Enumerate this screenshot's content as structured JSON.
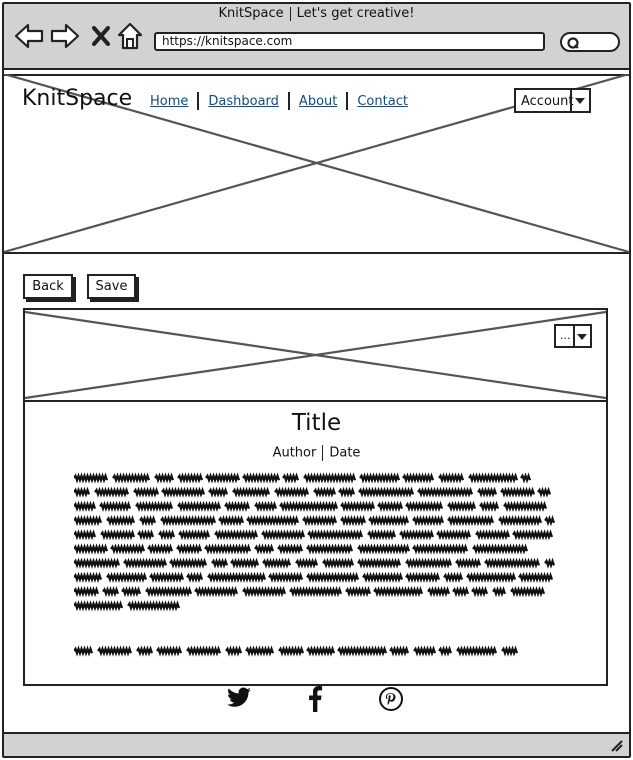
{
  "browser": {
    "title": "KnitSpace",
    "subtitle": "Let's get creative!",
    "url": "https://knitspace.com",
    "icons": [
      "back-arrow-icon",
      "forward-arrow-icon",
      "close-icon",
      "home-icon",
      "search-icon"
    ]
  },
  "header": {
    "logo": "KnitSpace",
    "nav": [
      "Home",
      "Dashboard",
      "About",
      "Contact"
    ],
    "account_label": "Account"
  },
  "toolbar": {
    "back_label": "Back",
    "save_label": "Save"
  },
  "image_menu": {
    "label": "..."
  },
  "article": {
    "title": "Title",
    "author": "Author",
    "date": "Date",
    "paragraph_lines": 10,
    "second_paragraph_lines": 1
  },
  "social": [
    "twitter-icon",
    "facebook-icon",
    "pinterest-icon"
  ],
  "colors": {
    "chrome": "#d2d2d2",
    "link": "#0b4f8a",
    "stroke": "#222222"
  }
}
